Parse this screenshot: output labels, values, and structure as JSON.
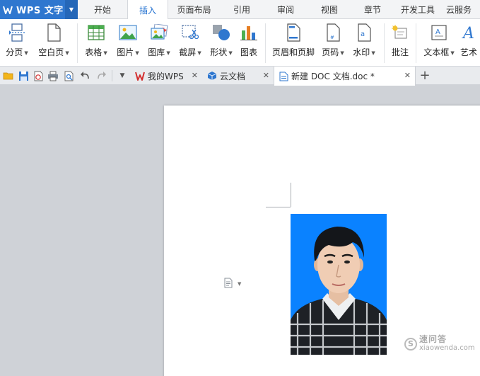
{
  "app": {
    "name": "WPS 文字"
  },
  "menu": {
    "tabs": [
      {
        "label": "开始"
      },
      {
        "label": "插入",
        "active": true
      },
      {
        "label": "页面布局"
      },
      {
        "label": "引用"
      },
      {
        "label": "审阅"
      },
      {
        "label": "视图"
      },
      {
        "label": "章节"
      },
      {
        "label": "开发工具"
      },
      {
        "label": "云服务"
      }
    ]
  },
  "ribbon": {
    "page_break": "分页",
    "blank_page": "空白页",
    "table": "表格",
    "picture": "图片",
    "gallery": "图库",
    "screenshot": "截屏",
    "shape": "形状",
    "chart": "图表",
    "header_footer": "页眉和页脚",
    "page_number": "页码",
    "watermark": "水印",
    "comment": "批注",
    "textbox": "文本框",
    "wordart": "艺术"
  },
  "doc_tabs": [
    {
      "label": "我的WPS",
      "icon": "wps-logo-icon"
    },
    {
      "label": "云文档",
      "icon": "cloud-cube-icon"
    },
    {
      "label": "新建 DOC 文档.doc *",
      "icon": "doc-file-icon",
      "active": true
    }
  ],
  "watermark": {
    "mark": "S",
    "line1": "速问答",
    "line2": "xiaowenda.com"
  },
  "colors": {
    "accent": "#2f77cf",
    "photo_bg": "#0a82ff",
    "tab_active_text": "#1f6fd0"
  }
}
